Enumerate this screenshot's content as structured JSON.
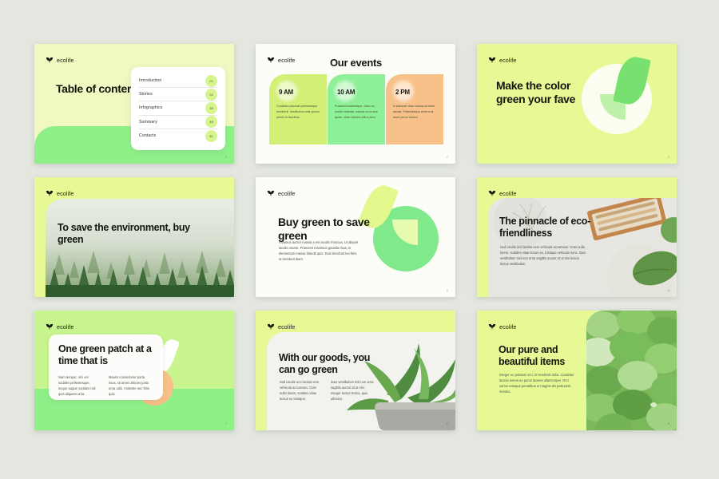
{
  "brand": {
    "name": "ecolife",
    "logo_icon": "leaf-sprout-icon"
  },
  "page": {
    "background_color": "#e3e7df"
  },
  "colors": {
    "lime": "#e7f994",
    "pale_lime": "#f1f8c2",
    "green": "#8ff08a",
    "mid_green": "#7fe98b",
    "orange": "#f7c189",
    "yellow_green": "#d2f075",
    "off_white": "#fbfdf6",
    "ink": "#14160f"
  },
  "slides": [
    {
      "id": "table-of-contents",
      "title": "Table of contents",
      "page_number": "1",
      "toc": [
        {
          "label": "Introduction",
          "number": "02"
        },
        {
          "label": "Stories",
          "number": "04"
        },
        {
          "label": "Infographics",
          "number": "38"
        },
        {
          "label": "Summary",
          "number": "48"
        },
        {
          "label": "Contacts",
          "number": "51"
        }
      ]
    },
    {
      "id": "our-events",
      "title": "Our events",
      "page_number": "2",
      "events": [
        {
          "time": "9 AM",
          "description": "Curabitur placerat pellentesque hendrerit. Vestibulum ante ipsum primis in faucibus."
        },
        {
          "time": "10 AM",
          "description": "Praesent scelerisque, dolor eu mollis molestie, mauris mi ornare quam, vitae ultrices velit a arcu."
        },
        {
          "time": "2 PM",
          "description": "In placerat vitae massa sit amet iaculis. Pellentesque viverra sit amet purus viverra."
        }
      ]
    },
    {
      "id": "make-the-color-green",
      "title": "Make the color green your fave",
      "page_number": "3"
    },
    {
      "id": "to-save-the-environment",
      "title": "To save the environment, buy green",
      "page_number": "4",
      "image_alt": "misty pine forest"
    },
    {
      "id": "buy-green-to-save-green",
      "title": "Buy green to save green",
      "page_number": "5",
      "body": "Vivamus auctor massa a est iaculis rhoncus. Ut aliquet iaculis ornare. Praesent maximus gravida risus, in elementum massa blandit quis. Duis tincidunt leo felis, ut tincidunt diam."
    },
    {
      "id": "the-pinnacle-of-eco-friendliness",
      "title": "The pinnacle of eco-friendliness",
      "page_number": "6",
      "body": "Sed iaculis orci lacinia sem vehicula accumsan. Cras nulla lorem, sodales vitae lectus eu, tristique vehicula nunc. Duis vestibulum nisl non urna sagittis auctor ut ut nisi lectus lectus vestibulum.",
      "image_alt": "wooden cutlery on white surface"
    },
    {
      "id": "one-green-patch",
      "title": "One green patch at a time that is",
      "page_number": "7",
      "body_left": "Nam tempor, orci vel sodales pellentesque, neque augue sodales nisl, quis aliquam urna.",
      "body_right": "Mauris consectetur porta risus, sit amet ultricies justo urna odio, molestie nec felis quis."
    },
    {
      "id": "with-our-goods",
      "title": "With our goods, you can go green",
      "page_number": "8",
      "body_left": "Sed iaculis orci lacinia sem vehicula accumsan. Cras nulla lorem, sodales vitae lectus eu tristique.",
      "body_right": "Duis vestibulum nisl non urna sagittis auctor at ut nisi. Integer lectus lectus, quis ultricies.",
      "image_alt": "succulent plant in concrete pot"
    },
    {
      "id": "our-pure-and-beautiful-items",
      "title": "Our pure and beautiful items",
      "page_number": "9",
      "body": "Integer eu pulvinar orci, in hendrerit dolor. Curabitur lacinia metus eu purus laoreet ullamcorper. Orci varius natoque penatibus et magnis dis parturient montes.",
      "image_alt": "close-up of round green leaves"
    }
  ]
}
